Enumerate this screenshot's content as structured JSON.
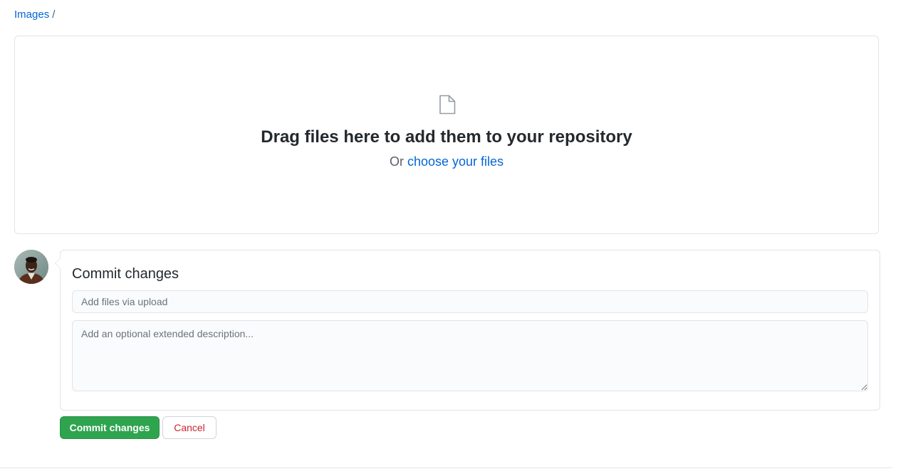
{
  "breadcrumb": {
    "folder_label": "Images",
    "separator": "/"
  },
  "dropzone": {
    "icon": "file-icon",
    "title": "Drag files here to add them to your repository",
    "sub_prefix": "Or",
    "choose_link": "choose your files"
  },
  "commit": {
    "avatar": "user-avatar",
    "title": "Commit changes",
    "summary_placeholder": "Add files via upload",
    "summary_value": "",
    "description_placeholder": "Add an optional extended description...",
    "description_value": ""
  },
  "actions": {
    "commit_label": "Commit changes",
    "cancel_label": "Cancel"
  },
  "colors": {
    "link": "#0366d6",
    "primary_button": "#2ea44f",
    "danger_text": "#cb2431",
    "border": "#e1e4e8"
  }
}
